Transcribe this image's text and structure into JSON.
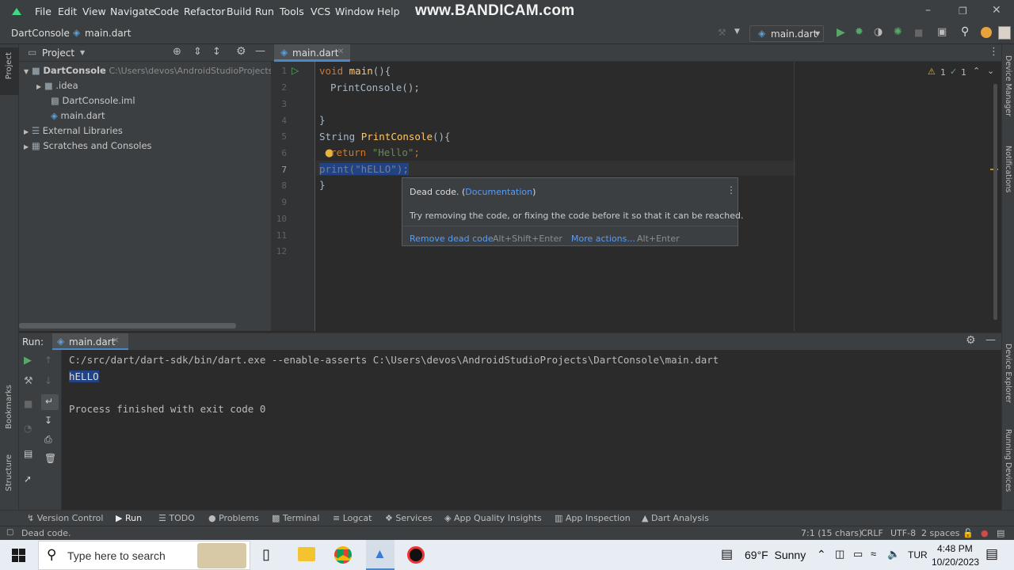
{
  "menu": {
    "items": [
      "File",
      "Edit",
      "View",
      "Navigate",
      "Code",
      "Refactor",
      "Build",
      "Run",
      "Tools",
      "VCS",
      "Window",
      "Help"
    ],
    "watermark": "www.BANDICAM.com"
  },
  "nav": {
    "project": "DartConsole",
    "file": "main.dart",
    "run_config": "main.dart"
  },
  "project_panel": {
    "title": "Project",
    "tree": [
      {
        "label": "DartConsole",
        "path": "C:\\Users\\devos\\AndroidStudioProjects\\Da"
      },
      {
        "label": ".idea"
      },
      {
        "label": "DartConsole.iml"
      },
      {
        "label": "main.dart"
      },
      {
        "label": "External Libraries"
      },
      {
        "label": "Scratches and Consoles"
      }
    ]
  },
  "sidebar_labels": {
    "project": "Project",
    "bookmarks": "Bookmarks",
    "structure": "Structure",
    "device_manager": "Device Manager",
    "notifications": "Notifications",
    "device_explorer": "Device Explorer",
    "running_devices": "Running Devices"
  },
  "editor": {
    "tab": "main.dart",
    "inspections": {
      "warnings": "1",
      "checks": "1"
    },
    "lines": [
      "1",
      "2",
      "3",
      "4",
      "5",
      "6",
      "7",
      "8",
      "9",
      "10",
      "11",
      "12"
    ],
    "code": {
      "l1_kw": "void",
      "l1_fn": "main",
      "l1_rest": "(){",
      "l2": "PrintConsole();",
      "l4": "}",
      "l5_type": "String ",
      "l5_fn": "PrintConsole",
      "l5_rest": "(){",
      "l6_kw": "return ",
      "l6_str": "\"Hello\"",
      "l6_end": ";",
      "l7": "print(\"hELLO\");",
      "l8": "}"
    }
  },
  "popup": {
    "title": "Dead code. (",
    "doc_link": "Documentation",
    "title_end": ")",
    "message": "Try removing the code, or fixing the code before it so that it can be reached.",
    "action1": "Remove dead code",
    "action1_key": "Alt+Shift+Enter",
    "action2": "More actions...",
    "action2_key": "Alt+Enter"
  },
  "run_panel": {
    "label": "Run:",
    "tab": "main.dart",
    "output": [
      "C:/src/dart/dart-sdk/bin/dart.exe --enable-asserts C:\\Users\\devos\\AndroidStudioProjects\\DartConsole\\main.dart",
      "hELLO",
      "",
      "Process finished with exit code 0"
    ]
  },
  "tool_windows": [
    "Version Control",
    "Run",
    "TODO",
    "Problems",
    "Terminal",
    "Logcat",
    "Services",
    "App Quality Insights",
    "App Inspection",
    "Dart Analysis"
  ],
  "status_bar": {
    "message": "Dead code.",
    "position": "7:1 (15 chars)",
    "line_sep": "CRLF",
    "encoding": "UTF-8",
    "indent": "2 spaces"
  },
  "taskbar": {
    "search_placeholder": "Type here to search",
    "weather": "69°F  Sunny",
    "lang": "TUR",
    "time": "4:48 PM",
    "date": "10/20/2023"
  },
  "colors": {
    "accent_link": "#589df6",
    "keyword": "#cc7832",
    "function": "#ffc66d",
    "string": "#6a8759",
    "run_green": "#59a869"
  }
}
